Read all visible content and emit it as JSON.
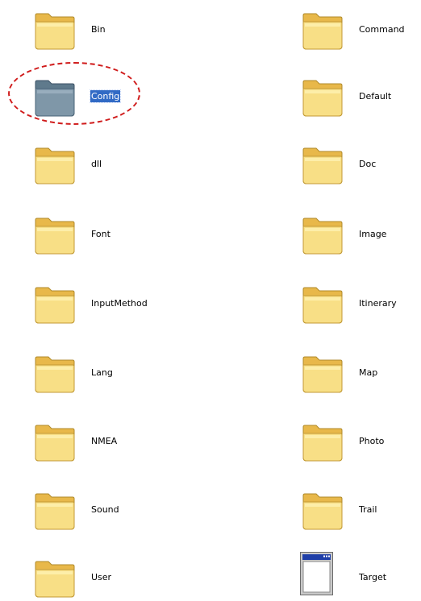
{
  "window": {
    "title": ""
  },
  "items": [
    {
      "label": "Bin",
      "icon": "folder-icon",
      "selected": false
    },
    {
      "label": "Command",
      "icon": "folder-icon",
      "selected": false
    },
    {
      "label": "Config",
      "icon": "folder-icon",
      "selected": true
    },
    {
      "label": "Default",
      "icon": "folder-icon",
      "selected": false
    },
    {
      "label": "dll",
      "icon": "folder-icon",
      "selected": false
    },
    {
      "label": "Doc",
      "icon": "folder-icon",
      "selected": false
    },
    {
      "label": "Font",
      "icon": "folder-icon",
      "selected": false
    },
    {
      "label": "Image",
      "icon": "folder-icon",
      "selected": false
    },
    {
      "label": "InputMethod",
      "icon": "folder-icon",
      "selected": false
    },
    {
      "label": "Itinerary",
      "icon": "folder-icon",
      "selected": false
    },
    {
      "label": "Lang",
      "icon": "folder-icon",
      "selected": false
    },
    {
      "label": "Map",
      "icon": "folder-icon",
      "selected": false
    },
    {
      "label": "NMEA",
      "icon": "folder-icon",
      "selected": false
    },
    {
      "label": "Photo",
      "icon": "folder-icon",
      "selected": false
    },
    {
      "label": "Sound",
      "icon": "folder-icon",
      "selected": false
    },
    {
      "label": "Trail",
      "icon": "folder-icon",
      "selected": false
    },
    {
      "label": "User",
      "icon": "folder-icon",
      "selected": false
    },
    {
      "label": "Target",
      "icon": "application-window-icon",
      "selected": false
    }
  ],
  "colors": {
    "folder_fill": "#f4d873",
    "folder_selected_fill": "#7f97a8",
    "selection_bg": "#316ac5",
    "highlight_ring": "#d01c1c"
  }
}
